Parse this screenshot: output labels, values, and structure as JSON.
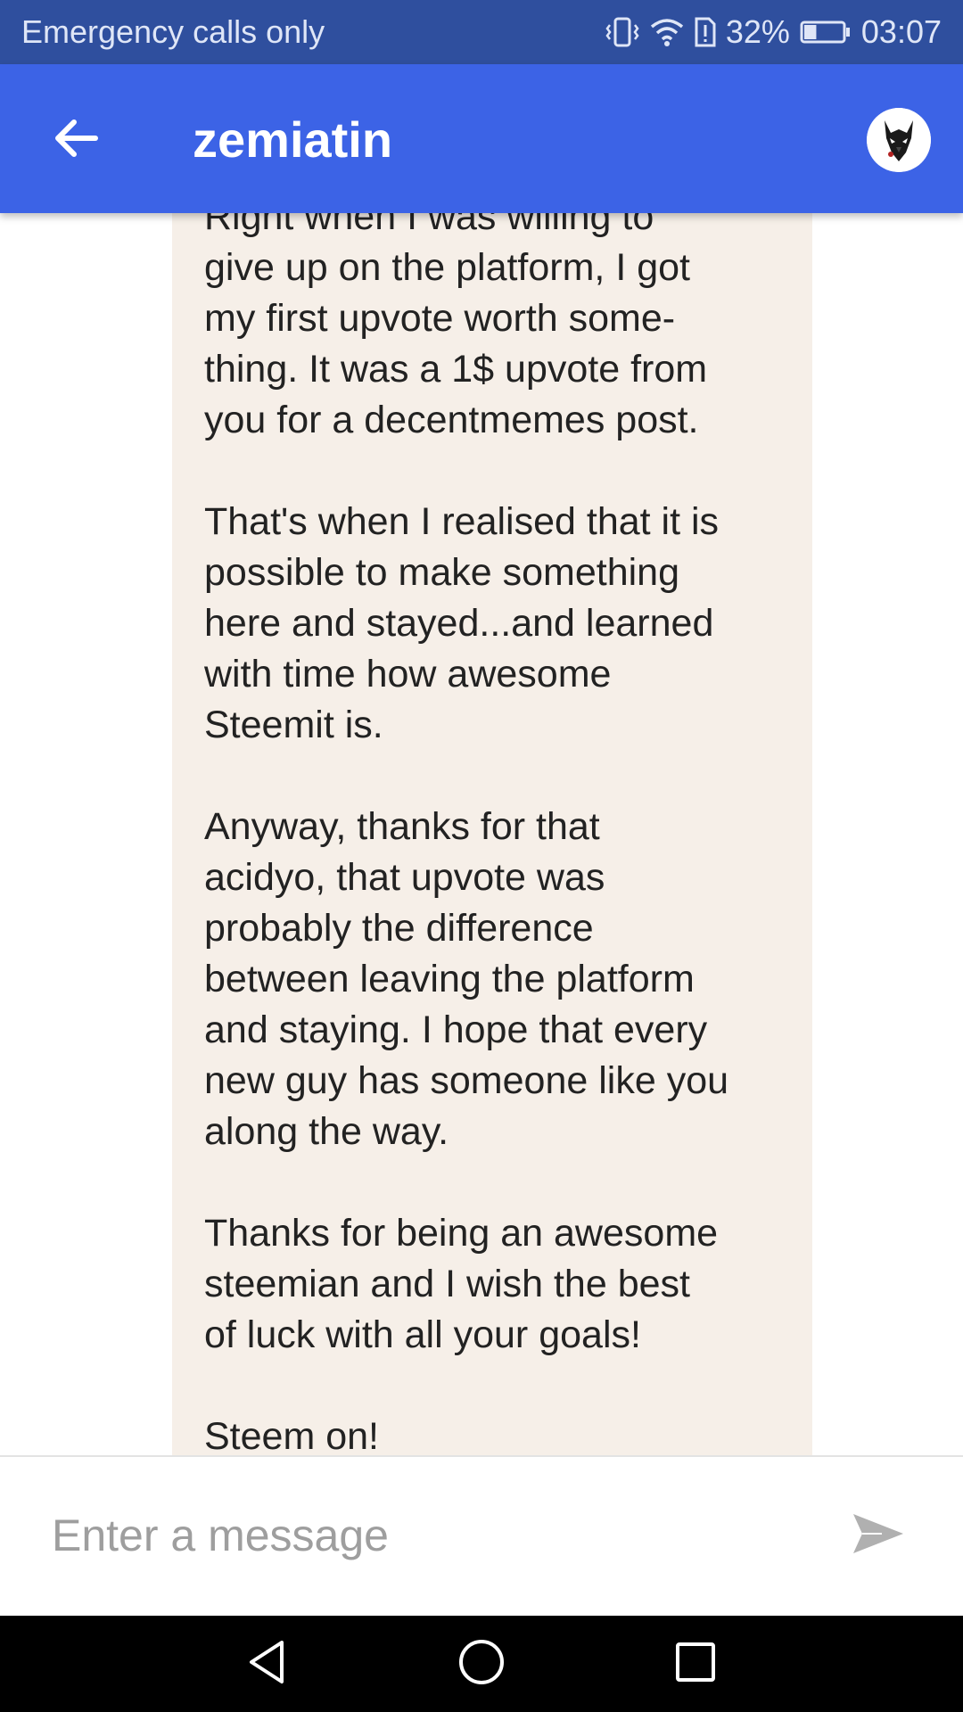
{
  "status_bar": {
    "carrier_text": "Emergency calls only",
    "battery_percent": "32%",
    "battery_level": 0.32,
    "time": "03:07",
    "icons": [
      "vibrate-icon",
      "wifi-icon",
      "alert-icon",
      "battery-icon"
    ]
  },
  "header": {
    "title": "zemiatin",
    "back_icon": "arrow-left-icon",
    "avatar_icon": "wolf-avatar"
  },
  "message": {
    "text": "Right when I was willing to\ngive up on the platform, I got\nmy first upvote worth some-\nthing. It was a 1$ upvote from\nyou for a decentmemes post.\n\nThat's when I realised that it is\npossible to make something\nhere and stayed...and learned\nwith time how awesome\nSteemit is.\n\nAnyway, thanks for that\nacidyo, that upvote was\nprobably the difference\nbetween leaving the platform\nand staying. I hope that every\nnew guy has someone like you\nalong the way.\n\nThanks for being an awesome\nsteemian and I wish the best\nof luck with all your goals!\n\nSteem on!"
  },
  "composer": {
    "placeholder": "Enter a message",
    "value": "",
    "send_icon": "send-icon"
  },
  "nav_bar": {
    "icons": [
      "back-triangle-icon",
      "home-circle-icon",
      "recents-square-icon"
    ]
  },
  "colors": {
    "status_bar": "#2f4f9e",
    "app_bar": "#3c63e6",
    "bubble": "#f6efe8",
    "nav_bar": "#000000"
  }
}
